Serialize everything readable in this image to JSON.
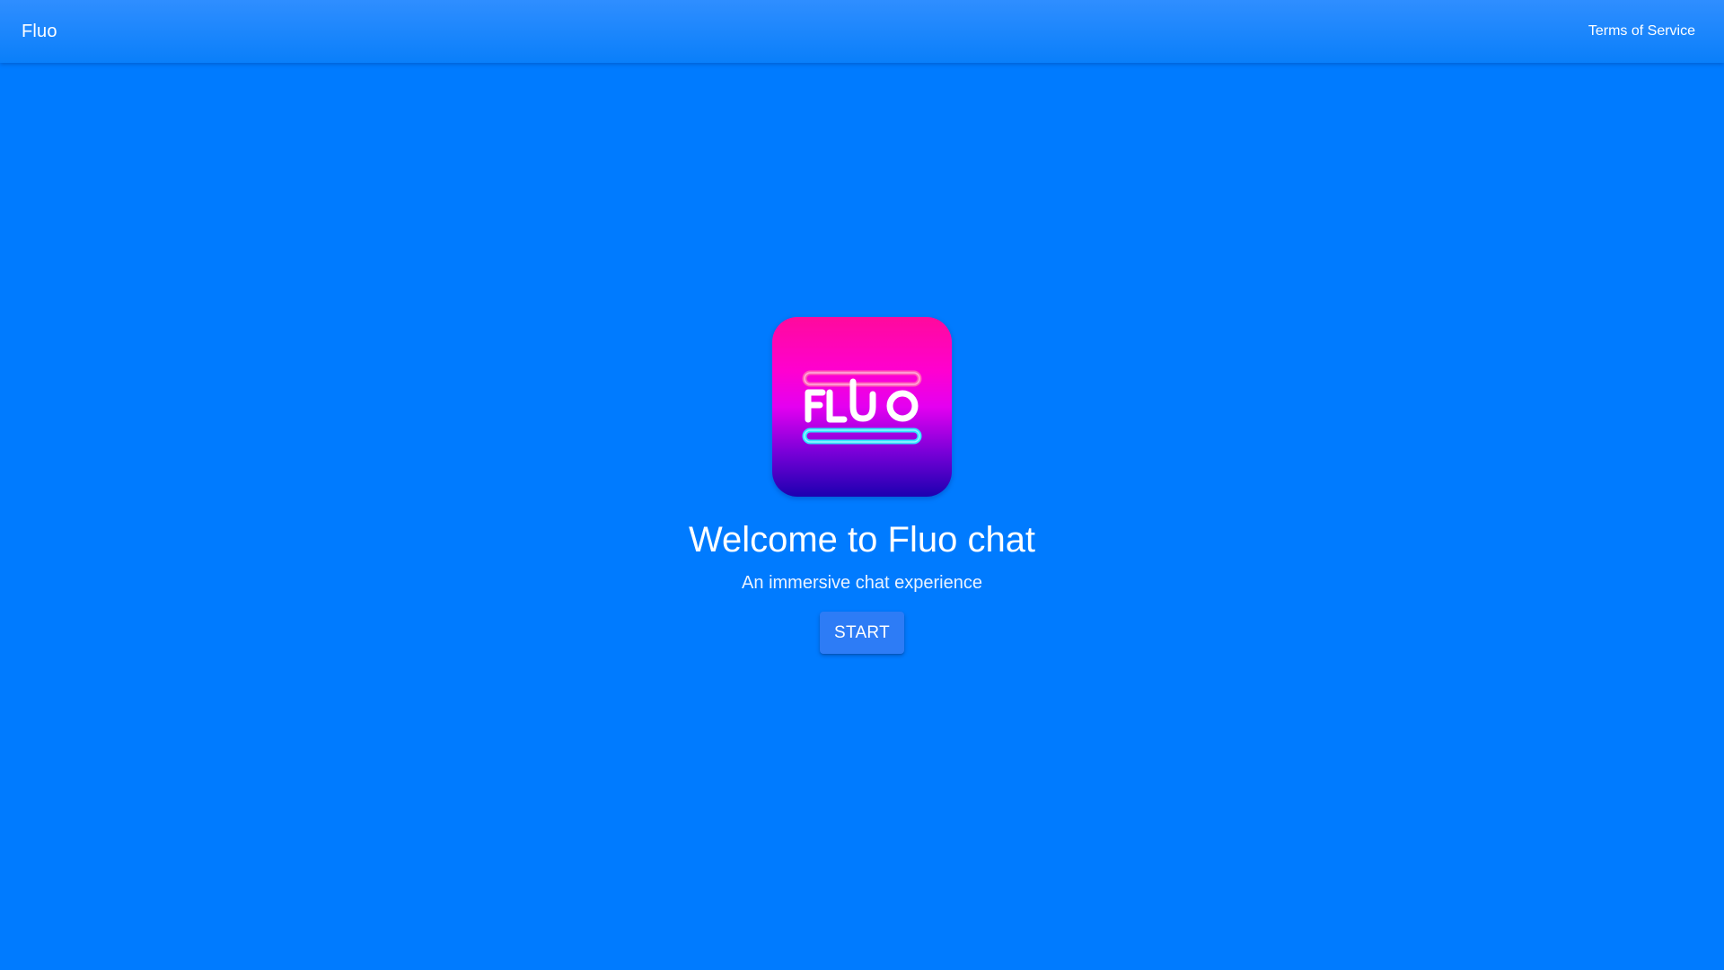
{
  "header": {
    "brand": "Fluo",
    "terms_link": "Terms of Service"
  },
  "hero": {
    "logo_icon": "fluo-logo-icon",
    "logo_text": "FLUO",
    "title": "Welcome to Fluo chat",
    "subtitle": "An immersive chat experience",
    "start_label": "START"
  },
  "colors": {
    "background": "#007bff",
    "header": "#2f8eff",
    "button": "#2d7cf6",
    "logo_top": "#ff0a9c",
    "logo_bottom": "#1c00b0",
    "logo_accent_pink": "#ff5cb8",
    "logo_accent_cyan": "#2ee6ff"
  }
}
